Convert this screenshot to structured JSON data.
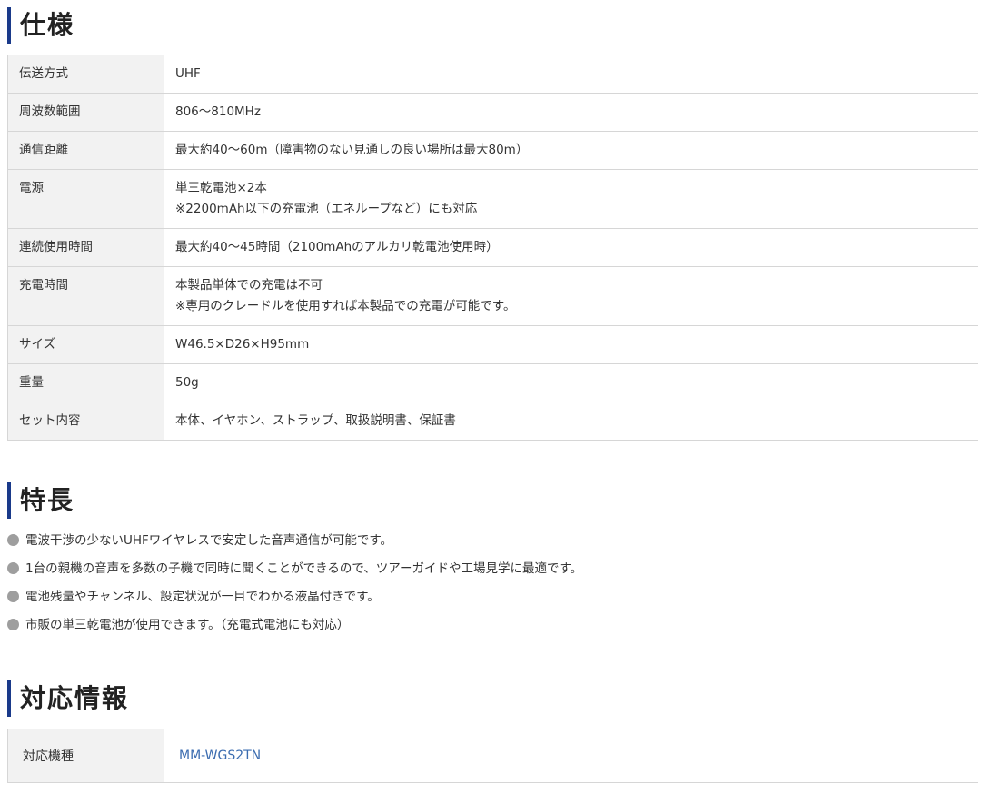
{
  "spec": {
    "title": "仕様",
    "rows": [
      {
        "label": "伝送方式",
        "lines": [
          "UHF"
        ]
      },
      {
        "label": "周波数範囲",
        "lines": [
          "806～810MHz"
        ]
      },
      {
        "label": "通信距離",
        "lines": [
          "最大約40～60m（障害物のない見通しの良い場所は最大80m）"
        ]
      },
      {
        "label": "電源",
        "lines": [
          "単三乾電池×2本",
          "※2200mAh以下の充電池（エネループなど）にも対応"
        ]
      },
      {
        "label": "連続使用時間",
        "lines": [
          "最大約40～45時間（2100mAhのアルカリ乾電池使用時）"
        ]
      },
      {
        "label": "充電時間",
        "lines": [
          "本製品単体での充電は不可",
          "※専用のクレードルを使用すれば本製品での充電が可能です。"
        ]
      },
      {
        "label": "サイズ",
        "lines": [
          "W46.5×D26×H95mm"
        ]
      },
      {
        "label": "重量",
        "lines": [
          "50g"
        ]
      },
      {
        "label": "セット内容",
        "lines": [
          "本体、イヤホン、ストラップ、取扱説明書、保証書"
        ]
      }
    ]
  },
  "features": {
    "title": "特長",
    "items": [
      "電波干渉の少ないUHFワイヤレスで安定した音声通信が可能です。",
      "1台の親機の音声を多数の子機で同時に聞くことができるので、ツアーガイドや工場見学に最適です。",
      "電池残量やチャンネル、設定状況が一目でわかる液晶付きです。",
      "市販の単三乾電池が使用できます。（充電式電池にも対応）"
    ]
  },
  "compat": {
    "title": "対応情報",
    "label": "対応機種",
    "model": "MM-WGS2TN"
  },
  "colors": {
    "accent": "#1a3a8a",
    "link": "#3b6cb0",
    "label_bg": "#f2f2f2",
    "border": "#d6d6d6",
    "bullet": "#9e9e9e"
  }
}
